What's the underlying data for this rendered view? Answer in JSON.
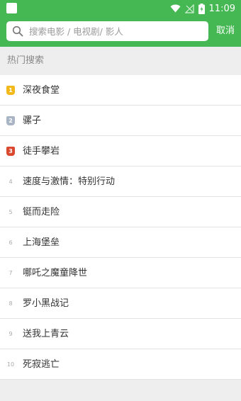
{
  "status_bar": {
    "time": "11:09"
  },
  "search": {
    "placeholder": "搜索电影 / 电视剧/ 影人",
    "value": "",
    "cancel_label": "取消"
  },
  "section": {
    "title": "热门搜索"
  },
  "colors": {
    "brand": "#45b853",
    "rank1": "#f3b81a",
    "rank2": "#a9b4c4",
    "rank3": "#d9482f"
  },
  "hot_list": [
    {
      "rank": "1",
      "title": "深夜食堂"
    },
    {
      "rank": "2",
      "title": "骡子"
    },
    {
      "rank": "3",
      "title": "徒手攀岩"
    },
    {
      "rank": "4",
      "title": "速度与激情：特别行动"
    },
    {
      "rank": "5",
      "title": "铤而走险"
    },
    {
      "rank": "6",
      "title": "上海堡垒"
    },
    {
      "rank": "7",
      "title": "哪吒之魔童降世"
    },
    {
      "rank": "8",
      "title": "罗小黑战记"
    },
    {
      "rank": "9",
      "title": "送我上青云"
    },
    {
      "rank": "10",
      "title": "死寂逃亡"
    }
  ]
}
